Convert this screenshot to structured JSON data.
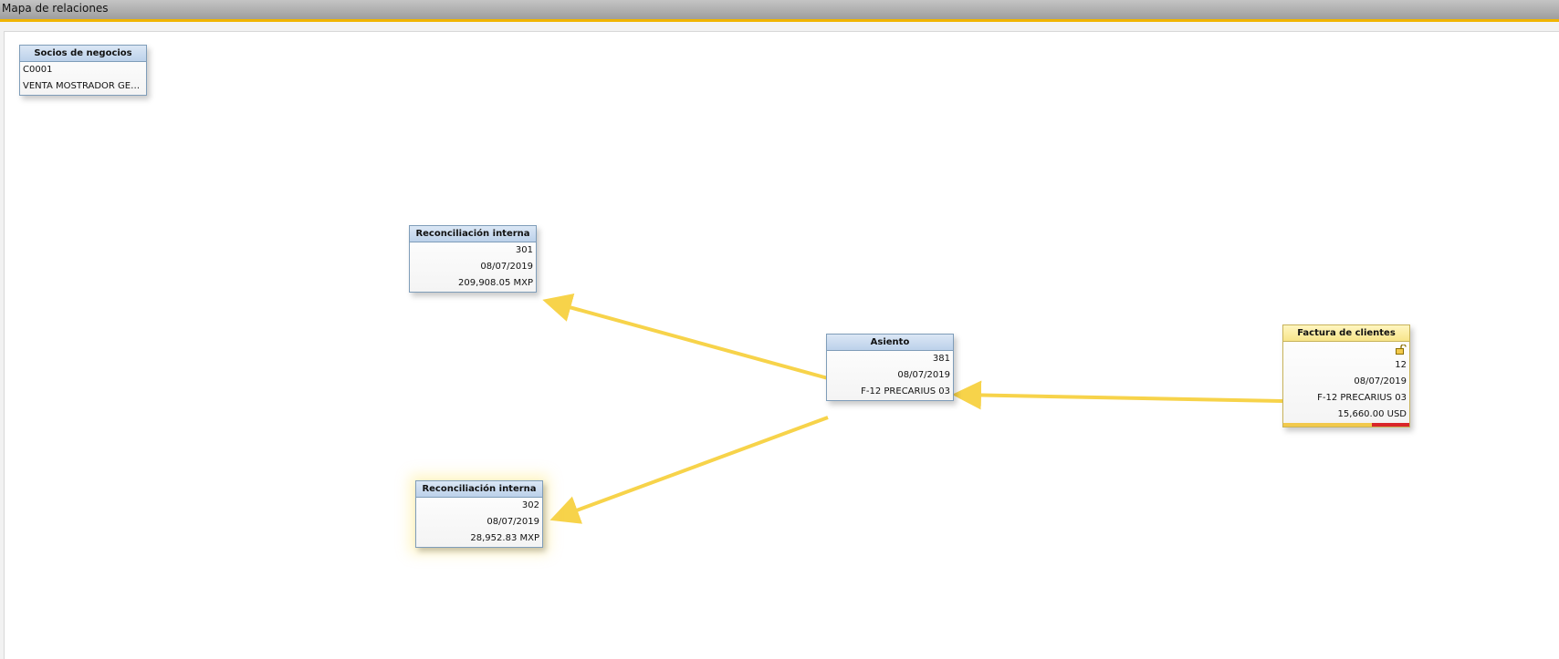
{
  "window": {
    "title": "Mapa de relaciones"
  },
  "colors": {
    "accent": "#f0b400",
    "link": "#f7d34a",
    "header_blue": "#bcd1ea",
    "header_yellow": "#f7e58a",
    "status_red": "#d9262a"
  },
  "nodes": {
    "business_partner": {
      "header": "Socios de negocios",
      "code": "C0001",
      "name": "VENTA MOSTRADOR GENERAL"
    },
    "reconciliation_1": {
      "header": "Reconciliación interna",
      "number": "301",
      "date": "08/07/2019",
      "amount": "209,908.05 MXP"
    },
    "reconciliation_2": {
      "header": "Reconciliación interna",
      "number": "302",
      "date": "08/07/2019",
      "amount": "28,952.83 MXP"
    },
    "journal_entry": {
      "header": "Asiento",
      "number": "381",
      "date": "08/07/2019",
      "reference": "F-12 PRECARIUS 03"
    },
    "customer_invoice": {
      "header": "Factura de clientes",
      "icon": "unlock-icon",
      "number": "12",
      "date": "08/07/2019",
      "reference": "F-12 PRECARIUS 03",
      "amount": "15,660.00 USD",
      "paid_fraction": 0.7
    }
  }
}
